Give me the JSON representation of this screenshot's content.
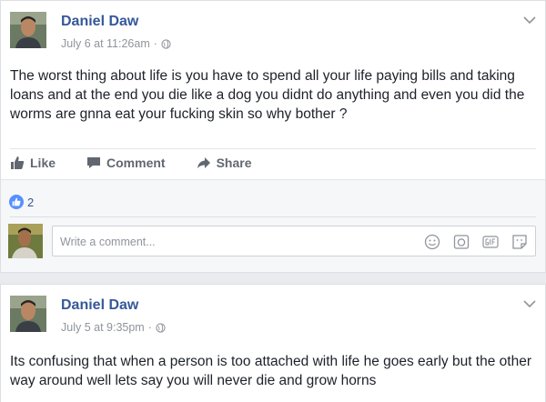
{
  "posts": [
    {
      "author": "Daniel Daw",
      "timestamp": "July 6 at 11:26am",
      "privacy_icon": "globe-icon",
      "text": "The worst thing about life is you have to spend all your life paying bills and taking loans and at the end you die like a dog you didnt do anything and even you did the worms are gnna eat your fucking skin so why bother ?",
      "actions": {
        "like": "Like",
        "comment": "Comment",
        "share": "Share"
      },
      "reactions_count": "2",
      "comment_placeholder": "Write a comment..."
    },
    {
      "author": "Daniel Daw",
      "timestamp": "July 5 at 9:35pm",
      "privacy_icon": "globe-icon",
      "text": "Its confusing that when a person is too attached with life he goes early but the other way around well lets say you will never die and grow horns"
    }
  ],
  "colors": {
    "author_blue": "#365899",
    "meta_gray": "#90949c",
    "action_gray": "#616770",
    "like_blue": "#5890ff",
    "feed_bg": "#e9ebee"
  },
  "icons": [
    "chevron-down-icon",
    "like-icon",
    "comment-icon",
    "share-icon",
    "emoji-icon",
    "camera-icon",
    "gif-icon",
    "sticker-icon"
  ]
}
